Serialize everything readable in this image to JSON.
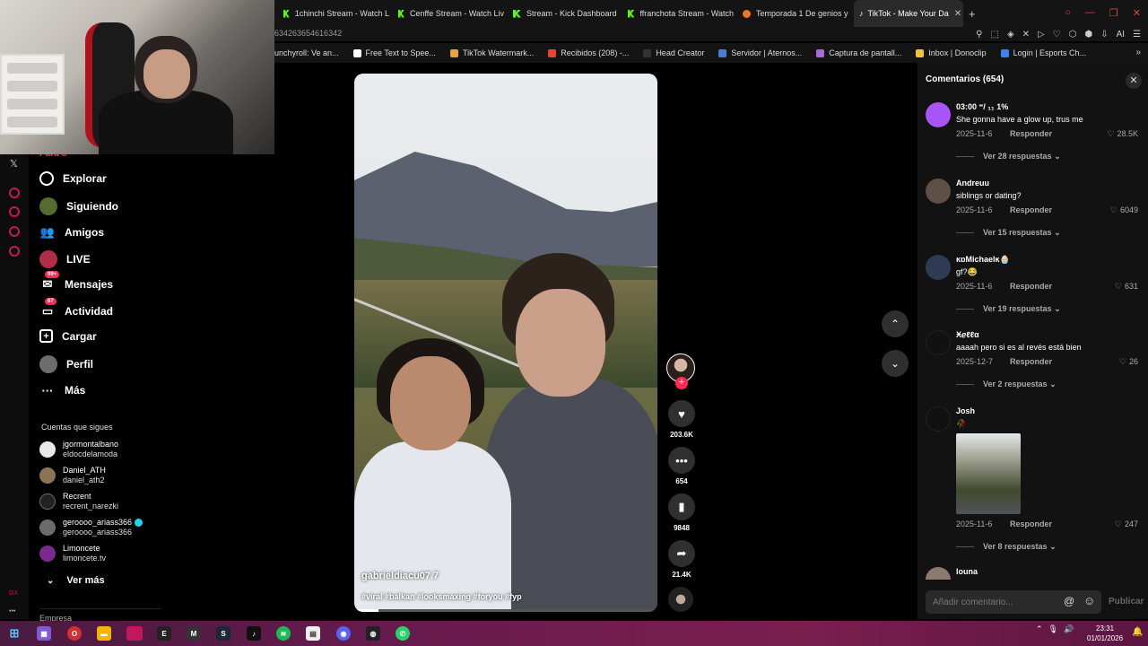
{
  "browser": {
    "tabs": [
      {
        "label": "1chinchi Stream - Watch L",
        "icon": "kick-icon",
        "active": false
      },
      {
        "label": "Cenffe Stream - Watch Liv",
        "icon": "kick-icon",
        "active": false
      },
      {
        "label": "Stream - Kick Dashboard",
        "icon": "kick-icon",
        "active": false
      },
      {
        "label": "ffranchota Stream - Watch",
        "icon": "kick-icon",
        "active": false
      },
      {
        "label": "Temporada 1 De genios y",
        "icon": "crunchyroll-icon",
        "active": false
      },
      {
        "label": "TikTok - Make Your Da",
        "icon": "tiktok-icon",
        "active": true
      }
    ],
    "url_fragment": "634263654616342",
    "bookmarks": [
      {
        "label": "unchyroll: Ve an...",
        "color": "#f47521"
      },
      {
        "label": "Free Text to Spee...",
        "color": "#ffffff"
      },
      {
        "label": "TikTok Watermark...",
        "color": "#e8a33d"
      },
      {
        "label": "Recibidos (208) -...",
        "color": "#ea4335"
      },
      {
        "label": "Head Creator",
        "color": "#333333"
      },
      {
        "label": "Servidor | Aternos...",
        "color": "#4a7bd8"
      },
      {
        "label": "Captura de pantall...",
        "color": "#a66bd6"
      },
      {
        "label": "Inbox | Donoclip",
        "color": "#f2c230"
      },
      {
        "label": "Login | Esports Ch...",
        "color": "#3b82f6"
      }
    ]
  },
  "nav": {
    "partial_top": "Para ti",
    "items": [
      {
        "label": "Explorar",
        "icon": "compass-icon"
      },
      {
        "label": "Siguiendo",
        "icon": "following-avatar-icon"
      },
      {
        "label": "Amigos",
        "icon": "friends-icon"
      },
      {
        "label": "LIVE",
        "icon": "live-icon"
      },
      {
        "label": "Mensajes",
        "icon": "messages-icon",
        "badge": "99+"
      },
      {
        "label": "Actividad",
        "icon": "activity-icon",
        "badge": "67"
      },
      {
        "label": "Cargar",
        "icon": "upload-icon"
      },
      {
        "label": "Perfil",
        "icon": "profile-avatar-icon"
      },
      {
        "label": "Más",
        "icon": "more-dots-icon"
      }
    ],
    "following_title": "Cuentas que sigues",
    "following": [
      {
        "name": "jgormontalbano",
        "handle": "eldocdelamoda",
        "color": "#e9e9e9",
        "verified": false
      },
      {
        "name": "Daniel_ATH",
        "handle": "daniel_ath2",
        "color": "#8b7355",
        "verified": false
      },
      {
        "name": "Recrent",
        "handle": "recrent_narezki",
        "color": "#222222",
        "verified": false
      },
      {
        "name": "geroooo_ariass366",
        "handle": "geroooo_ariass366",
        "color": "#6b6b6b",
        "verified": true
      },
      {
        "name": "Limoncete",
        "handle": "limoncete.tv",
        "color": "#7a2b8f",
        "verified": false
      }
    ],
    "see_more": "Ver más",
    "company": "Empresa"
  },
  "video": {
    "author": "gabrieldiacu07.7",
    "hashtags": "#viral #balkan #looksmaxing #foryou #fyp",
    "progress": 0.08,
    "likes": "203.6K",
    "comments": "654",
    "saves": "9848",
    "shares": "21.4K"
  },
  "comments": {
    "title": "Comentarios (654)",
    "reply_label": "Responder",
    "input_placeholder": "Añadir comentario...",
    "post_label": "Publicar",
    "items": [
      {
        "user": "03:00 ⁼/ ₁₁ 1%",
        "text": "She gonna have a glow up, trus me",
        "date": "2025-11-6",
        "likes": "28.5K",
        "replies": "Ver 28 respuestas",
        "avatar_color": "#a855f7"
      },
      {
        "user": "Andreuu",
        "text": "siblings or dating?",
        "date": "2025-11-6",
        "likes": "6049",
        "replies": "Ver 15 respuestas",
        "avatar_color": "#5d5047"
      },
      {
        "user": "ĸɒMichaelĸ🧁",
        "text": "gf?😂",
        "date": "2025-11-6",
        "likes": "631",
        "replies": "Ver 19 respuestas",
        "avatar_color": "#2f3b55"
      },
      {
        "user": "Ӿℯℓℓα",
        "text": "aaaah pero si es al revés está bien",
        "date": "2025-12-7",
        "likes": "26",
        "replies": "Ver 2 respuestas",
        "avatar_color": "#111111"
      },
      {
        "user": "Josh",
        "text": "🥀",
        "date": "2025-11-6",
        "likes": "247",
        "replies": "Ver 8 respuestas",
        "avatar_color": "#111111"
      },
      {
        "user": "louna",
        "avatar_color": "#8a7a70"
      }
    ]
  },
  "taskbar": {
    "time": "23:31",
    "date": "01/01/2026"
  }
}
